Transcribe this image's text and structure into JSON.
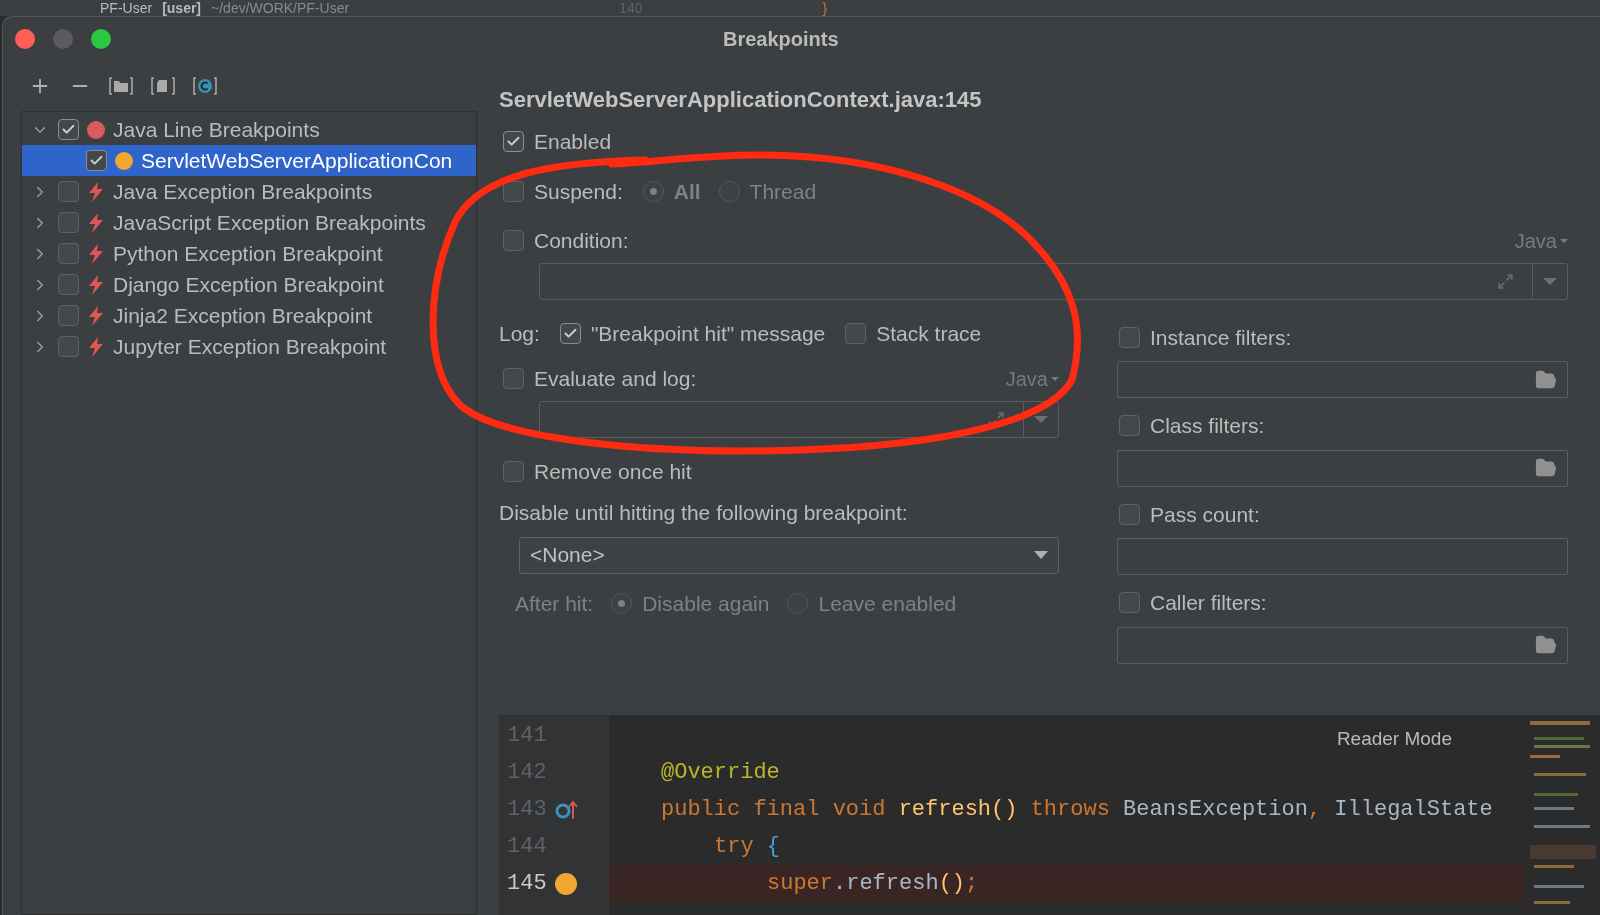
{
  "background_ide": {
    "project": "PF-User",
    "project_tag": "[user]",
    "path": "~/dev/WORK/PF-User",
    "line_number": "140",
    "code": "}"
  },
  "window": {
    "title": "Breakpoints"
  },
  "tree": [
    {
      "label": "Java Line Breakpoints",
      "kind": "line",
      "checked": true,
      "expanded": true,
      "selected": false,
      "children": [
        {
          "label": "ServletWebServerApplicationCon",
          "kind": "line-item",
          "checked": true,
          "selected": true
        }
      ]
    },
    {
      "label": "Java Exception Breakpoints",
      "kind": "exception",
      "checked": false,
      "expanded": false,
      "selected": false
    },
    {
      "label": "JavaScript Exception Breakpoints",
      "kind": "exception",
      "checked": false,
      "expanded": false,
      "selected": false
    },
    {
      "label": "Python Exception Breakpoint",
      "kind": "exception",
      "checked": false,
      "expanded": false,
      "selected": false
    },
    {
      "label": "Django Exception Breakpoint",
      "kind": "exception",
      "checked": false,
      "expanded": false,
      "selected": false
    },
    {
      "label": "Jinja2 Exception Breakpoint",
      "kind": "exception",
      "checked": false,
      "expanded": false,
      "selected": false
    },
    {
      "label": "Jupyter Exception Breakpoint",
      "kind": "exception",
      "checked": false,
      "expanded": false,
      "selected": false
    }
  ],
  "details": {
    "title": "ServletWebServerApplicationContext.java:145",
    "enabled": {
      "label": "Enabled",
      "checked": true
    },
    "suspend": {
      "label": "Suspend:",
      "checked": false,
      "options": [
        {
          "label": "All",
          "selected": true
        },
        {
          "label": "Thread",
          "selected": false
        }
      ]
    },
    "condition": {
      "label": "Condition:",
      "checked": false,
      "language": "Java"
    },
    "log": {
      "label": "Log:",
      "options": [
        {
          "label": "\"Breakpoint hit\" message",
          "checked": true
        },
        {
          "label": "Stack trace",
          "checked": false
        }
      ]
    },
    "evaluate": {
      "label": "Evaluate and log:",
      "checked": false,
      "language": "Java"
    },
    "remove_once_hit": {
      "label": "Remove once hit",
      "checked": false
    },
    "disable_until": {
      "label": "Disable until hitting the following breakpoint:",
      "value": "<None>"
    },
    "after_hit": {
      "label": "After hit:",
      "options": [
        {
          "label": "Disable again",
          "selected": true
        },
        {
          "label": "Leave enabled",
          "selected": false
        }
      ]
    },
    "filters": [
      {
        "label": "Instance filters:",
        "checked": false,
        "browse": true
      },
      {
        "label": "Class filters:",
        "checked": false,
        "browse": true
      },
      {
        "label": "Pass count:",
        "checked": false,
        "browse": false
      },
      {
        "label": "Caller filters:",
        "checked": false,
        "browse": true
      }
    ]
  },
  "editor": {
    "reader_mode": "Reader Mode",
    "lines": [
      {
        "number": "141",
        "current": false,
        "breakpoint": false,
        "override_marker": false
      },
      {
        "number": "142",
        "current": false,
        "breakpoint": false,
        "override_marker": false,
        "tokens": [
          {
            "kind": "annotation",
            "text": "@Override"
          }
        ]
      },
      {
        "number": "143",
        "current": false,
        "breakpoint": false,
        "override_marker": true,
        "tokens": [
          {
            "kind": "keyword",
            "text": "public final void "
          },
          {
            "kind": "method",
            "text": "refresh()"
          },
          {
            "kind": "keyword",
            "text": " throws "
          },
          {
            "kind": "plain",
            "text": "BeansException"
          },
          {
            "kind": "keyword",
            "text": ", "
          },
          {
            "kind": "plain",
            "text": "IllegalState"
          }
        ],
        "children": [
          {
            "number": "144",
            "current": false,
            "breakpoint": false,
            "override_marker": false,
            "tokens": [
              {
                "kind": "keyword",
                "text": "try "
              },
              {
                "kind": "brace",
                "text": "{"
              }
            ],
            "children": [
              {
                "number": "145",
                "current": true,
                "breakpoint": true,
                "override_marker": false,
                "tokens": [
                  {
                    "kind": "keyword",
                    "text": "super"
                  },
                  {
                    "kind": "plain",
                    "text": ".refresh"
                  },
                  {
                    "kind": "method",
                    "text": "()"
                  },
                  {
                    "kind": "keyword",
                    "text": ";"
                  }
                ]
              }
            ]
          }
        ]
      }
    ]
  },
  "annotation": {
    "kind": "circle"
  }
}
